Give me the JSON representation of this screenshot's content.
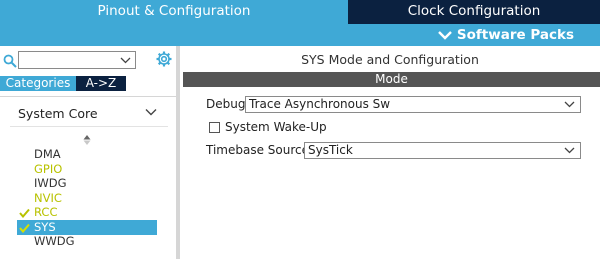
{
  "tabs": {
    "pinout": "Pinout & Configuration",
    "clock": "Clock Configuration"
  },
  "software_packs": "Software Packs",
  "sidebar": {
    "search_value": "",
    "segments": {
      "categories": "Categories",
      "az": "A->Z"
    },
    "group": "System Core",
    "items": [
      {
        "label": "DMA",
        "state": "default",
        "checked": false
      },
      {
        "label": "GPIO",
        "state": "configured",
        "checked": false
      },
      {
        "label": "IWDG",
        "state": "default",
        "checked": false
      },
      {
        "label": "NVIC",
        "state": "configured",
        "checked": false
      },
      {
        "label": "RCC",
        "state": "configured",
        "checked": true
      },
      {
        "label": "SYS",
        "state": "selected",
        "checked": true
      },
      {
        "label": "WWDG",
        "state": "default",
        "checked": false
      }
    ]
  },
  "panel": {
    "title": "SYS Mode and Configuration",
    "section": "Mode",
    "debug_label": "Debug",
    "debug_value": "Trace Asynchronous Sw",
    "wakeup_label": "System Wake-Up",
    "wakeup_checked": false,
    "timebase_label": "Timebase Source",
    "timebase_value": "SysTick"
  },
  "colors": {
    "accent": "#3fa9d6",
    "dark_navy": "#0b2140",
    "mode_bar": "#555555",
    "configured_text": "#b8c200"
  }
}
